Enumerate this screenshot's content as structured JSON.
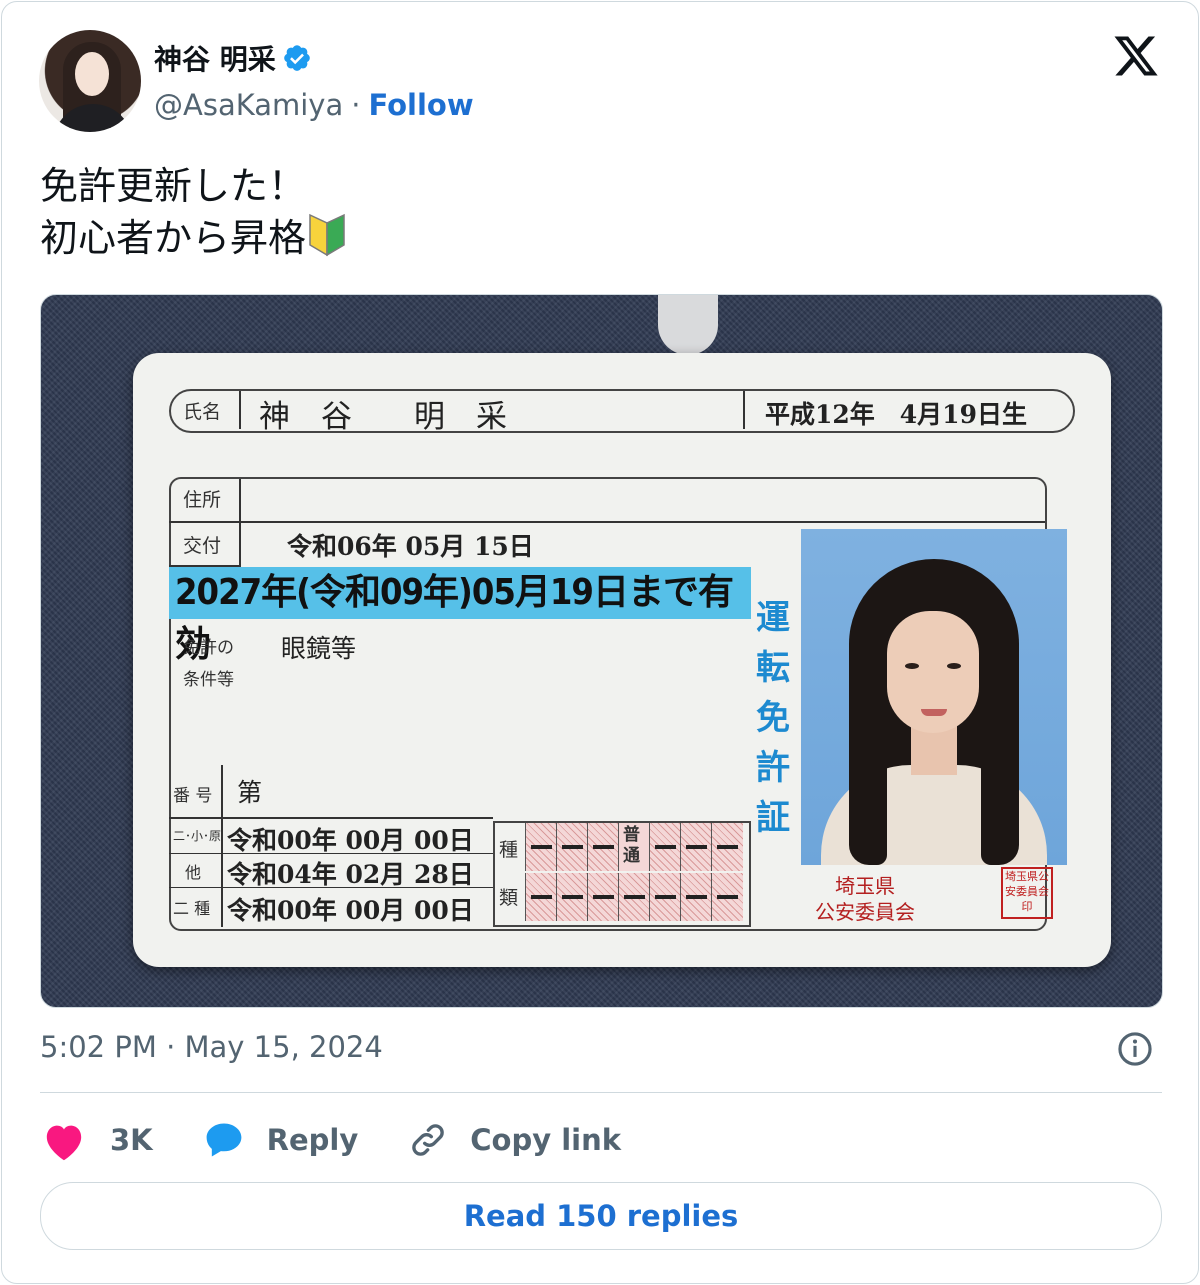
{
  "author": {
    "display_name": "神谷 明采",
    "handle": "@AsaKamiya",
    "separator": "·",
    "follow_label": "Follow",
    "verified": true
  },
  "tweet": {
    "text": "免許更新した！\n初心者から昇格",
    "emoji": "beginner-driver-mark"
  },
  "license": {
    "name_label": "氏名",
    "name": "神　谷　　明　采",
    "birth": "平成12年　4月19日生",
    "address_label": "住所",
    "issue_label": "交付",
    "issue_date": "令和06年 05月 15日",
    "validity": "2027年(令和09年)05月19日まで有効",
    "conditions_label_1": "免許の",
    "conditions_label_2": "条件等",
    "conditions": "眼鏡等",
    "number_label": "番 号",
    "number_prefix": "第",
    "row1_label": "二･小･原",
    "row1_date": "令和00年 00月 00日",
    "row2_label": "他",
    "row2_date": "令和04年 02月 28日",
    "row3_label": "二 種",
    "row3_date": "令和00年 00月 00日",
    "type_label_1": "種",
    "type_label_2": "類",
    "type_highlight": "普通",
    "title_vertical": "運転免許証",
    "issuer_1": "埼玉県",
    "issuer_2": "公安委員会",
    "seal_text": "埼玉県公安委員会印"
  },
  "meta": {
    "time": "5:02 PM · May 15, 2024"
  },
  "actions": {
    "like_count": "3K",
    "reply_label": "Reply",
    "copy_label": "Copy link"
  },
  "read_replies_label": "Read 150 replies",
  "colors": {
    "link_blue": "#1d6fd1",
    "like_pink": "#f91880",
    "reply_blue": "#1d9bf0",
    "muted": "#536471",
    "license_blue": "#56c0e8"
  }
}
